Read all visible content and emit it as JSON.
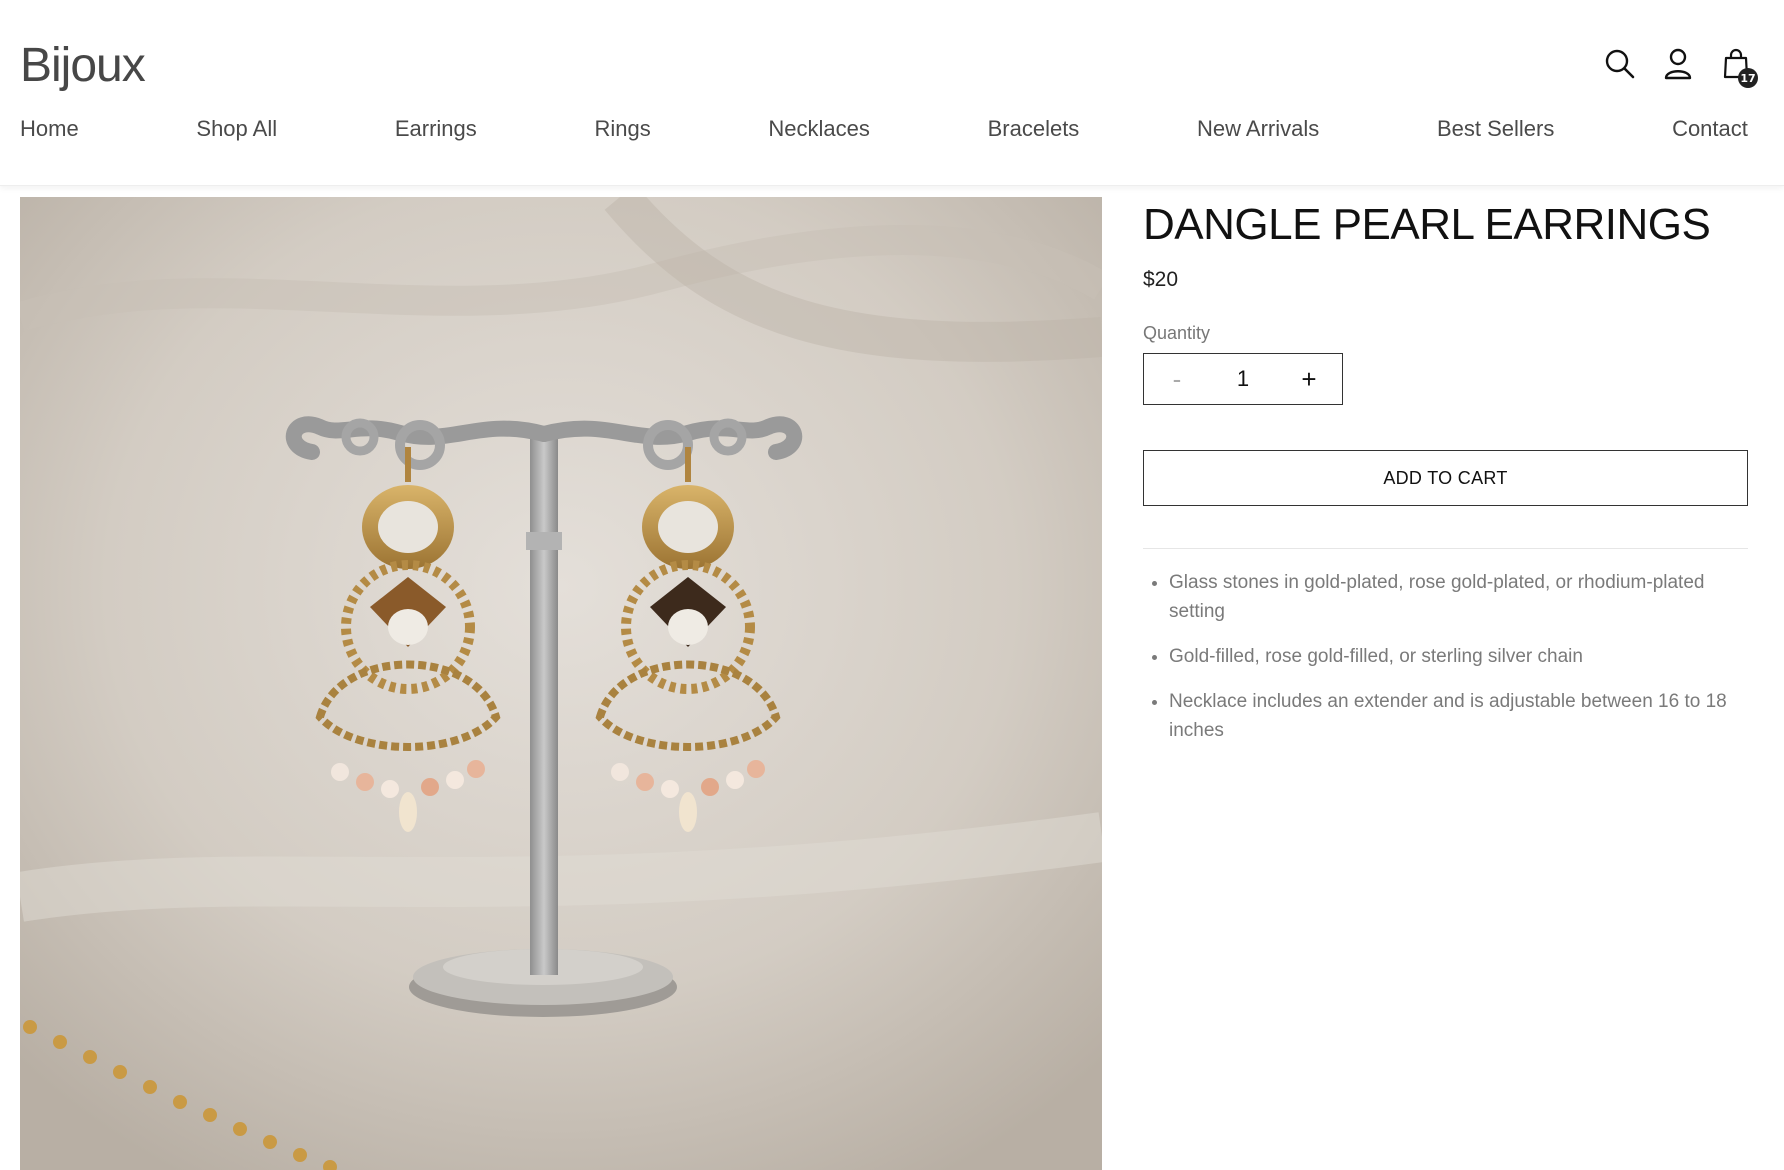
{
  "brand": {
    "logo_text": "Bijoux"
  },
  "header": {
    "icons": {
      "search": "search-icon",
      "account": "user-icon",
      "cart": "shopping-bag-icon"
    },
    "cart_count": "17"
  },
  "nav": {
    "items": [
      {
        "label": "Home"
      },
      {
        "label": "Shop All"
      },
      {
        "label": "Earrings"
      },
      {
        "label": "Rings"
      },
      {
        "label": "Necklaces"
      },
      {
        "label": "Bracelets"
      },
      {
        "label": "New Arrivals"
      },
      {
        "label": "Best Sellers"
      },
      {
        "label": "Contact"
      }
    ]
  },
  "product": {
    "title": "DANGLE PEARL EARRINGS",
    "price": "$20",
    "quantity_label": "Quantity",
    "quantity_value": "1",
    "minus_label": "-",
    "plus_label": "+",
    "add_to_cart_label": "ADD TO CART",
    "features": [
      "Glass stones in gold-plated, rose gold-plated, or rhodium-plated setting",
      "Gold-filled, rose gold-filled, or sterling silver chain",
      "Necklace includes an extender and is adjustable between 16 to 18 inches"
    ]
  },
  "colors": {
    "text_dark": "#111111",
    "text_muted": "#7a7a7a",
    "border": "#333333"
  }
}
